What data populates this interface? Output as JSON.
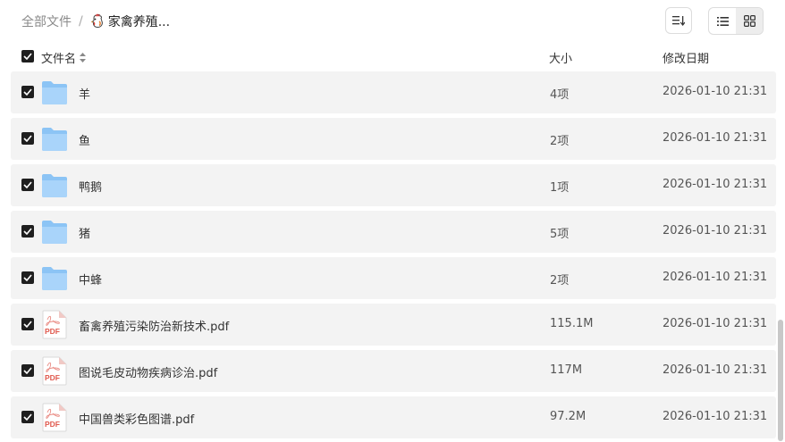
{
  "breadcrumb": {
    "root": "全部文件",
    "separator": "/",
    "current": "家禽养殖..."
  },
  "toolbar": {
    "sort_icon": "sort-icon",
    "list_view_icon": "list-view-icon",
    "grid_view_icon": "grid-view-icon"
  },
  "header": {
    "name": "文件名",
    "size": "大小",
    "date": "修改日期"
  },
  "files": [
    {
      "name": "羊",
      "size": "4项",
      "date": "2026-01-10 21:31",
      "type": "folder"
    },
    {
      "name": "鱼",
      "size": "2项",
      "date": "2026-01-10 21:31",
      "type": "folder"
    },
    {
      "name": "鸭鹅",
      "size": "1项",
      "date": "2026-01-10 21:31",
      "type": "folder"
    },
    {
      "name": "猪",
      "size": "5项",
      "date": "2026-01-10 21:31",
      "type": "folder"
    },
    {
      "name": "中蜂",
      "size": "2项",
      "date": "2026-01-10 21:31",
      "type": "folder"
    },
    {
      "name": "畜禽养殖污染防治新技术.pdf",
      "size": "115.1M",
      "date": "2026-01-10 21:31",
      "type": "pdf"
    },
    {
      "name": "图说毛皮动物疾病诊治.pdf",
      "size": "117M",
      "date": "2026-01-10 21:31",
      "type": "pdf"
    },
    {
      "name": "中国兽类彩色图谱.pdf",
      "size": "97.2M",
      "date": "2026-01-10 21:31",
      "type": "pdf"
    }
  ],
  "pdf_badge": "PDF",
  "colors": {
    "folder": "#8cc4f5",
    "pdf_red": "#e05a4f",
    "checkbox": "#1f1f1f",
    "row_bg": "#f3f3f3"
  }
}
